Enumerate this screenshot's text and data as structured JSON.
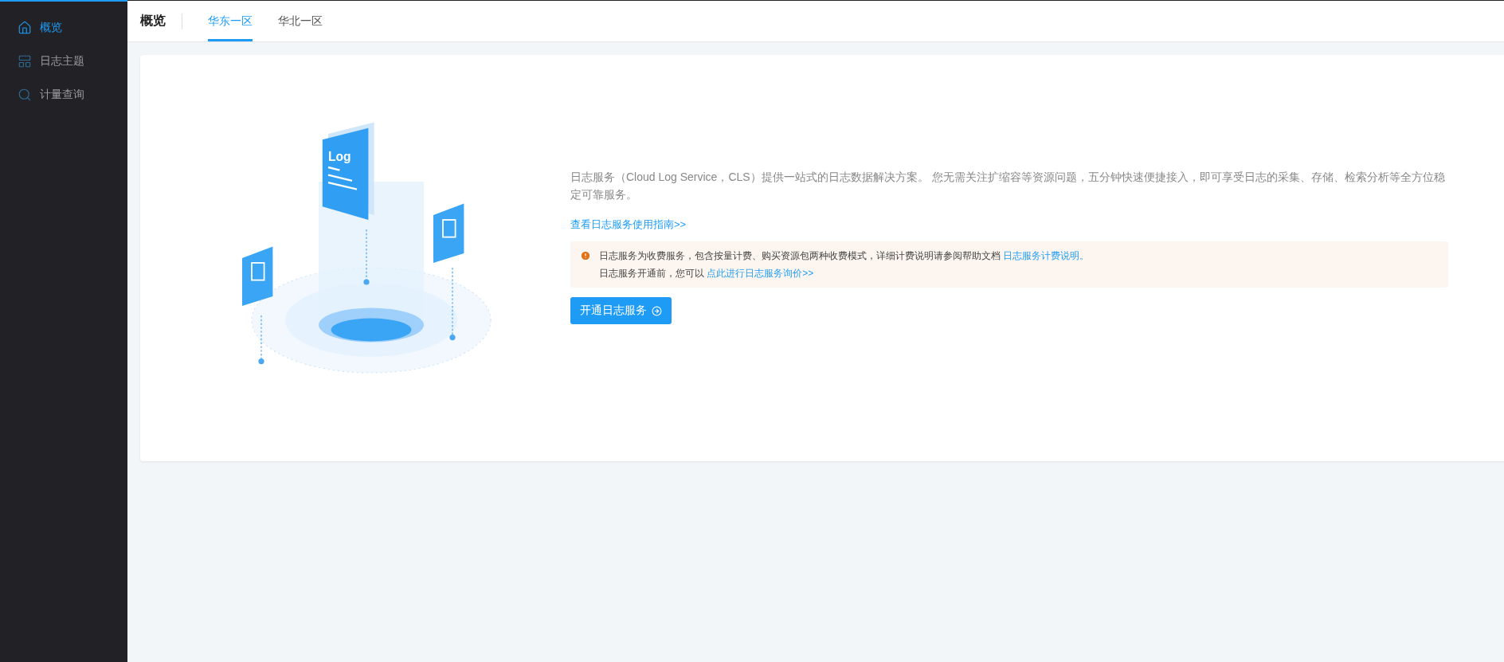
{
  "sidebar": {
    "items": [
      {
        "label": "概览",
        "selected": true
      },
      {
        "label": "日志主题",
        "selected": false
      },
      {
        "label": "计量查询",
        "selected": false
      }
    ]
  },
  "header": {
    "title": "概览",
    "tabs": [
      {
        "label": "华东一区",
        "selected": true
      },
      {
        "label": "华北一区",
        "selected": false
      }
    ]
  },
  "intro": {
    "illustration_label": "Log",
    "description": "日志服务（Cloud Log Service，CLS）提供一站式的日志数据解决方案。 您无需关注扩缩容等资源问题，五分钟快速便捷接入，即可享受日志的采集、存储、检索分析等全方位稳定可靠服务。",
    "guide_link": "查看日志服务使用指南>>",
    "notice": {
      "line1": "日志服务为收费服务，包含按量计费、购买资源包两种收费模式，详细计费说明请参阅帮助文档",
      "line1_link": "日志服务计费说明。",
      "line2": "日志服务开通前，您可以",
      "line2_link": "点此进行日志服务询价>>"
    },
    "button": "开通日志服务"
  }
}
